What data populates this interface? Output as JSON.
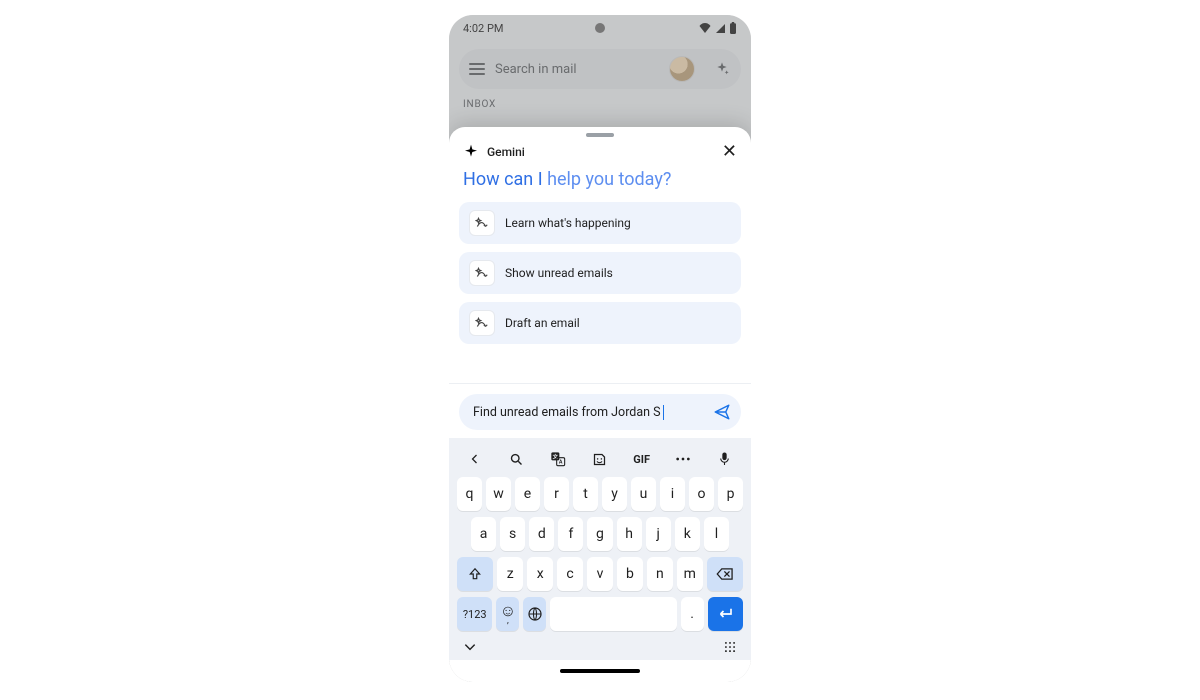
{
  "status": {
    "time": "4:02 PM"
  },
  "gmail": {
    "search_placeholder": "Search in mail",
    "inbox_label": "INBOX"
  },
  "sheet": {
    "title": "Gemini",
    "headline_a": "How can I ",
    "headline_b": "help you today?",
    "suggestions": [
      {
        "label": "Learn what's happening"
      },
      {
        "label": "Show unread emails"
      },
      {
        "label": "Draft an email"
      }
    ],
    "input_value": "Find unread emails from Jordan S"
  },
  "keyboard": {
    "toolbar": {
      "gif": "GIF"
    },
    "row1": [
      "q",
      "w",
      "e",
      "r",
      "t",
      "y",
      "u",
      "i",
      "o",
      "p"
    ],
    "row2": [
      "a",
      "s",
      "d",
      "f",
      "g",
      "h",
      "j",
      "k",
      "l"
    ],
    "row3": [
      "z",
      "x",
      "c",
      "v",
      "b",
      "n",
      "m"
    ],
    "numkey": "?123",
    "period": ".",
    "comma": ","
  }
}
